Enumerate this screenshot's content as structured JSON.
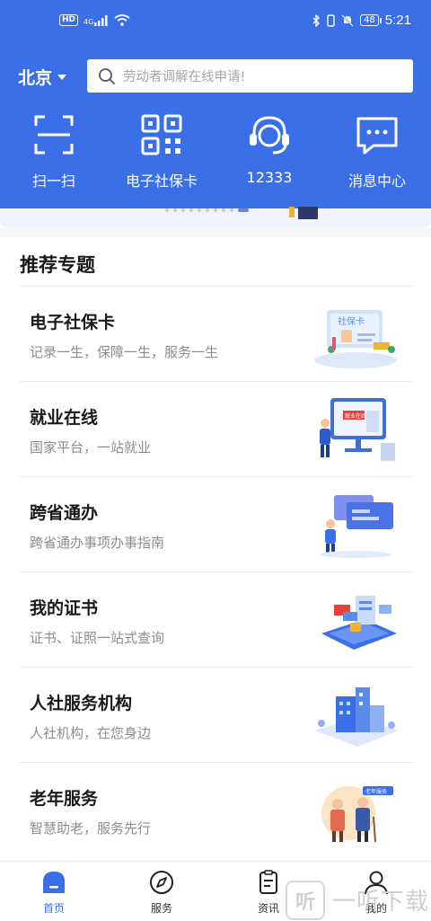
{
  "status_bar": {
    "network_badge": "HD",
    "signal": "4G",
    "battery": "48",
    "time": "5:21"
  },
  "header": {
    "city": "北京",
    "search_placeholder": "劳动者调解在线申请!"
  },
  "quick_nav": [
    {
      "label": "扫一扫",
      "icon": "scan-icon"
    },
    {
      "label": "电子社保卡",
      "icon": "qr-code-icon"
    },
    {
      "label": "12333",
      "icon": "headset-icon"
    },
    {
      "label": "消息中心",
      "icon": "message-icon"
    }
  ],
  "section": {
    "title": "推荐专题"
  },
  "topics": [
    {
      "title": "电子社保卡",
      "desc": "记录一生，保障一生，服务一生",
      "image_text": "社保卡"
    },
    {
      "title": "就业在线",
      "desc": "国家平台，一站就业",
      "image_text": "就业在线"
    },
    {
      "title": "跨省通办",
      "desc": "跨省通办事项办事指南"
    },
    {
      "title": "我的证书",
      "desc": "证书、证照一站式查询"
    },
    {
      "title": "人社服务机构",
      "desc": "人社机构，在您身边"
    },
    {
      "title": "老年服务",
      "desc": "智慧助老，服务先行",
      "image_text": "老年服务"
    }
  ],
  "tabbar": [
    {
      "label": "首页",
      "icon": "home-icon",
      "active": true
    },
    {
      "label": "服务",
      "icon": "compass-icon",
      "active": false
    },
    {
      "label": "资讯",
      "icon": "news-icon",
      "active": false
    },
    {
      "label": "我的",
      "icon": "user-icon",
      "active": false
    }
  ],
  "watermark": {
    "badge": "听",
    "text": "一听下载"
  },
  "colors": {
    "primary": "#3a6fe8",
    "text": "#1a1a1a",
    "muted": "#8c8c8c",
    "divider": "#ececec"
  }
}
